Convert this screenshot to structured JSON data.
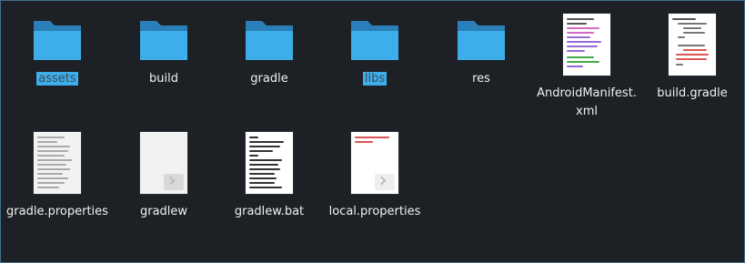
{
  "files": [
    {
      "name": "assets",
      "type": "folder",
      "selected": true
    },
    {
      "name": "build",
      "type": "folder",
      "selected": false
    },
    {
      "name": "gradle",
      "type": "folder",
      "selected": false
    },
    {
      "name": "libs",
      "type": "folder",
      "selected": true
    },
    {
      "name": "res",
      "type": "folder",
      "selected": false
    },
    {
      "name": "AndroidManifest.xml",
      "type": "xml",
      "selected": false
    },
    {
      "name": "build.gradle",
      "type": "gradle",
      "selected": false
    },
    {
      "name": "gradle.properties",
      "type": "properties",
      "selected": false
    },
    {
      "name": "gradlew",
      "type": "script",
      "selected": false
    },
    {
      "name": "gradlew.bat",
      "type": "bat",
      "selected": false
    },
    {
      "name": "local.properties",
      "type": "properties",
      "selected": false
    }
  ],
  "labels": {
    "f0": "assets",
    "f1": "build",
    "f2": "gradle",
    "f3": "libs",
    "f4": "res",
    "f5a": "AndroidManifest.",
    "f5b": "xml",
    "f6": "build.gradle",
    "f7": "gradle.properties",
    "f8": "gradlew",
    "f9": "gradlew.bat",
    "f10": "local.properties"
  },
  "colors": {
    "background": "#1d2126",
    "selection": "#3daee9",
    "folder_front": "#3daee9",
    "folder_back": "#2a7fb8",
    "text": "#eff0f1"
  }
}
